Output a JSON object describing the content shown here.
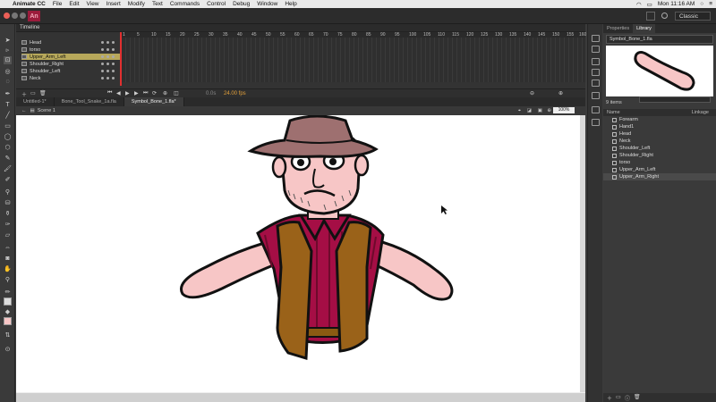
{
  "menubar": {
    "app": "Animate CC",
    "items": [
      "File",
      "Edit",
      "View",
      "Insert",
      "Modify",
      "Text",
      "Commands",
      "Control",
      "Debug",
      "Window",
      "Help"
    ],
    "clock": "Mon 11:16 AM"
  },
  "appbar": {
    "logo": "An",
    "workspace": "Classic"
  },
  "timeline": {
    "title": "Timeline",
    "layers": [
      {
        "name": "Head",
        "selected": false
      },
      {
        "name": "torso",
        "selected": false
      },
      {
        "name": "Upper_Arm_Left",
        "selected": true
      },
      {
        "name": "Shoulder_Right",
        "selected": false
      },
      {
        "name": "Shoulder_Left",
        "selected": false
      },
      {
        "name": "Neck",
        "selected": false
      }
    ],
    "frame_numbers": [
      "1",
      "5",
      "10",
      "15",
      "20",
      "25",
      "30",
      "35",
      "40",
      "45",
      "50",
      "55",
      "60",
      "65",
      "70",
      "75",
      "80",
      "85",
      "90",
      "95",
      "100",
      "105",
      "110",
      "115",
      "120",
      "125",
      "130",
      "135",
      "140",
      "145",
      "150",
      "155",
      "160"
    ],
    "fps": "24.00 fps",
    "time": "0.0s"
  },
  "doc_tabs": [
    {
      "label": "Untitled-1*",
      "active": false
    },
    {
      "label": "Bone_Tool_Snake_1a.fla",
      "active": false
    },
    {
      "label": "Symbol_Bone_1.fla*",
      "active": true
    }
  ],
  "scene": {
    "label": "Scene 1",
    "zoom": "100%"
  },
  "library": {
    "tabs": [
      "Properties",
      "Library"
    ],
    "document": "Symbol_Bone_1.fla",
    "item_count": "9 items",
    "col_name": "Name",
    "col_linkage": "Linkage",
    "items": [
      {
        "name": "Forearm",
        "selected": false
      },
      {
        "name": "Hand1",
        "selected": false
      },
      {
        "name": "Head",
        "selected": false
      },
      {
        "name": "Neck",
        "selected": false
      },
      {
        "name": "Shoulder_Left",
        "selected": false
      },
      {
        "name": "Shoulder_Right",
        "selected": false
      },
      {
        "name": "torso",
        "selected": false
      },
      {
        "name": "Upper_Arm_Left",
        "selected": false
      },
      {
        "name": "Upper_Arm_Right",
        "selected": true
      }
    ]
  },
  "colors": {
    "skin": "#f7c6c6",
    "hat": "#9e7070",
    "shirt": "#a50e45",
    "vest": "#9a6219",
    "accent": "#9b1c3c"
  }
}
